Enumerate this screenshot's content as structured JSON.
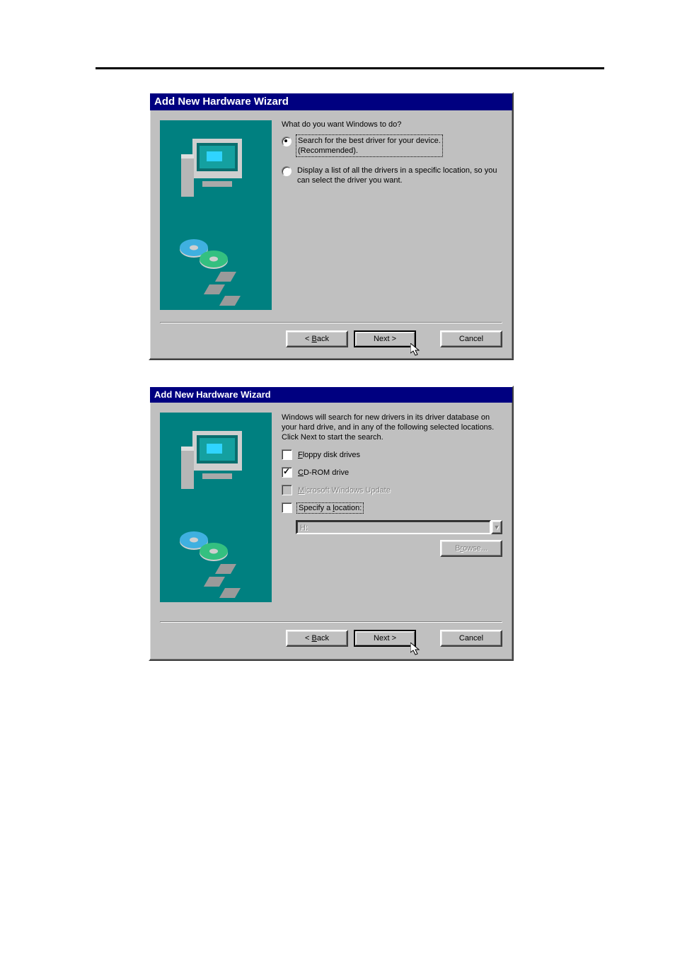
{
  "dialog1": {
    "title": "Add New Hardware Wizard",
    "prompt": "What do you want Windows to do?",
    "option_search": "Search for the best driver for your device. (Recommended).",
    "option_list": "Display a list of all the drivers in a specific location, so you can select the driver you want.",
    "back": "< Back",
    "next": "Next >",
    "cancel": "Cancel"
  },
  "dialog2": {
    "title": "Add New Hardware Wizard",
    "prompt": "Windows will search for new drivers in its driver database on your hard drive, and in any of the following selected locations. Click Next to start the search.",
    "floppy": "Floppy disk drives",
    "cdrom": "CD-ROM drive",
    "winupdate": "Microsoft Windows Update",
    "specify": "Specify a location:",
    "path": "H:",
    "browse": "Browse...",
    "back": "< Back",
    "next": "Next >",
    "cancel": "Cancel"
  }
}
